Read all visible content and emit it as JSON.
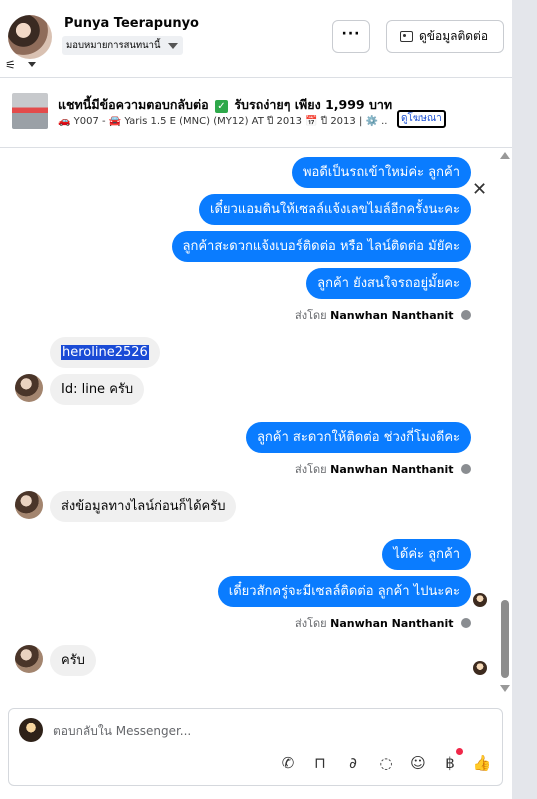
{
  "header": {
    "contact_name": "Punya Teerapunyo",
    "assign_label": "มอบหมายการสนทนานี้",
    "more_label": "···",
    "contact_info_label": "ดูข้อมูลติดต่อ"
  },
  "ad": {
    "title": "แชทนี้มีข้อความตอบกลับต่อ",
    "title_suffix": "รับรถง่ายๆ เพียง 1,999 บาท",
    "subtitle": "🚗 Y007 - 🚘 Yaris 1.5 E (MNC) (MY12) AT ปี 2013 📅 ปี 2013 | ⚙️ ..",
    "link_label": "ดูโฆษณา",
    "close": "✕"
  },
  "messages": {
    "m1": "พอดีเป็นรถเข้าใหม่ค่ะ  ลูกค้า",
    "m2": "เดี๋ยวแอมดินให้เซลล์แจ้งเลขไมล์อีกครั้งนะคะ",
    "m3": "ลูกค้าสะดวกแจ้งเบอร์ติดต่อ หรือ ไลน์ติดต่อ มัยัคะ",
    "m4": "ลูกค้า ยังสนใจรถอยู่มั้ยคะ",
    "sent_by_prefix": "ส่งโดย",
    "sent_by_name": "Nanwhan Nanthanit",
    "in1": "heroline2526",
    "in2": "Id: line ครับ",
    "m5": "ลูกค้า สะดวกให้ติดต่อ ช่วงกี่โมงดีคะ",
    "in3": "ส่งข้อมูลทางไลน์ก่อนก็ได้ครับ",
    "m6": "ได้ค่ะ  ลูกค้า",
    "m7": "เดี๋ยวสักครู่จะมีเซลล์ติดต่อ ลูกค้า ไปนะคะ",
    "in4": "ครับ"
  },
  "composer": {
    "placeholder": "ตอบกลับใน Messenger..."
  },
  "icons": [
    "filter-icon",
    "call-icon",
    "bag-icon",
    "attach-icon",
    "chat-icon",
    "emoji-icon",
    "currency-icon",
    "like-icon",
    "close-icon"
  ]
}
